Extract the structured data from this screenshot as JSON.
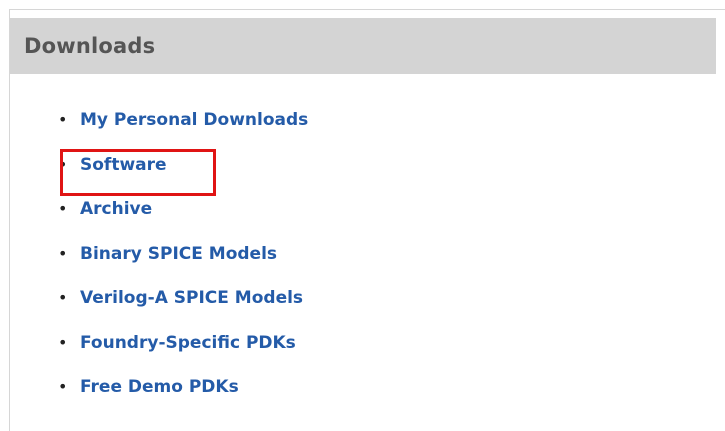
{
  "panel": {
    "title": "Downloads"
  },
  "downloads": [
    {
      "label": "My Personal Downloads"
    },
    {
      "label": "Software"
    },
    {
      "label": "Archive"
    },
    {
      "label": "Binary SPICE Models"
    },
    {
      "label": "Verilog-A SPICE Models"
    },
    {
      "label": "Foundry-Specific PDKs"
    },
    {
      "label": "Free Demo PDKs"
    }
  ],
  "colors": {
    "header_background": "#d4d4d4",
    "link": "#245ba8",
    "highlight": "#e01414"
  },
  "icons": {
    "bullet": "bullet-icon"
  }
}
